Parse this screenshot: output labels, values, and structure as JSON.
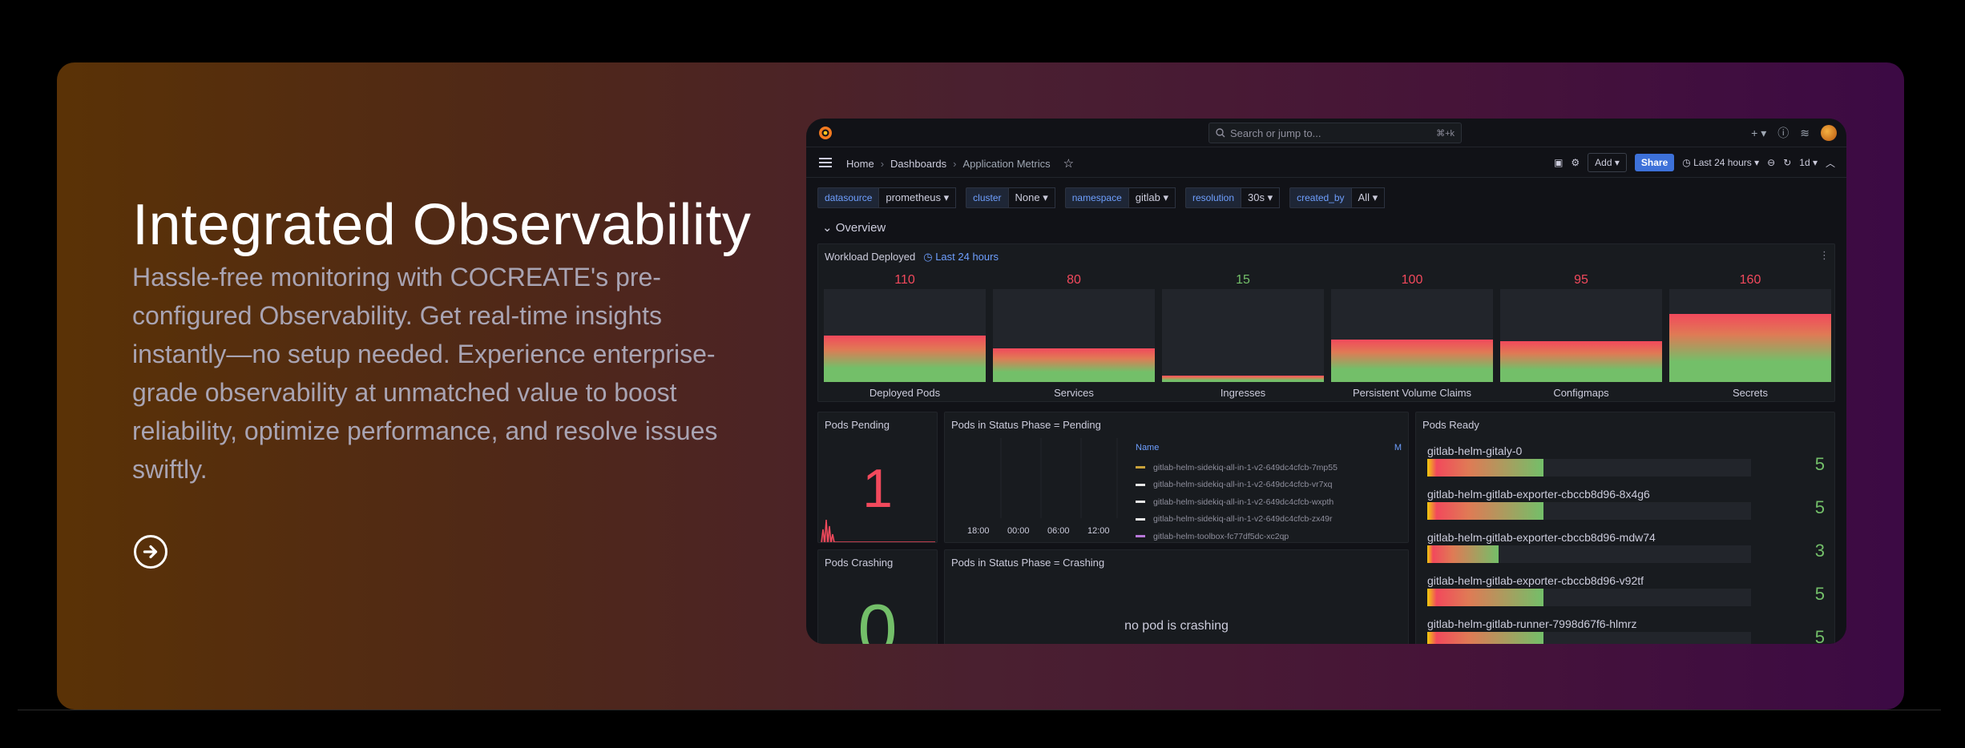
{
  "hero": {
    "title": "Integrated Observability",
    "description": "Hassle-free monitoring with COCREATE's pre-configured Observability. Get real-time insights instantly—no setup needed. Experience enterprise-grade observability at unmatched value to boost reliability, optimize performance, and resolve issues swiftly."
  },
  "grafana": {
    "search_placeholder": "Search or jump to...",
    "search_shortcut": "⌘+k",
    "breadcrumb": [
      "Home",
      "Dashboards",
      "Application Metrics"
    ],
    "nav": {
      "add_label": "Add",
      "share_label": "Share",
      "time_range": "Last 24 hours",
      "refresh_interval": "1d"
    },
    "variables": [
      {
        "label": "datasource",
        "value": "prometheus"
      },
      {
        "label": "cluster",
        "value": "None"
      },
      {
        "label": "namespace",
        "value": "gitlab"
      },
      {
        "label": "resolution",
        "value": "30s"
      },
      {
        "label": "created_by",
        "value": "All"
      }
    ],
    "row_title": "Overview",
    "workload": {
      "title": "Workload Deployed",
      "time": "Last 24 hours",
      "stats": [
        {
          "label": "Deployed Pods",
          "value": "110",
          "fraction": 0.5,
          "color": "#f2495c"
        },
        {
          "label": "Services",
          "value": "80",
          "fraction": 0.36,
          "color": "#f2495c"
        },
        {
          "label": "Ingresses",
          "value": "15",
          "fraction": 0.07,
          "color": "#73bf69"
        },
        {
          "label": "Persistent Volume Claims",
          "value": "100",
          "fraction": 0.46,
          "color": "#f2495c"
        },
        {
          "label": "Configmaps",
          "value": "95",
          "fraction": 0.44,
          "color": "#f2495c"
        },
        {
          "label": "Secrets",
          "value": "160",
          "fraction": 0.73,
          "color": "#f2495c"
        }
      ]
    },
    "pods_pending": {
      "title": "Pods Pending",
      "value": "1",
      "color": "#f2495c"
    },
    "pods_crashing": {
      "title": "Pods Crashing",
      "value": "0",
      "color": "#73bf69"
    },
    "phase_pending": {
      "title": "Pods in Status Phase = Pending",
      "x_ticks": [
        "18:00",
        "00:00",
        "06:00",
        "12:00"
      ],
      "legend_header": "Name",
      "legend_header_right": "M",
      "legend": [
        {
          "name": "gitlab-helm-sidekiq-all-in-1-v2-649dc4cfcb-7mp55",
          "color": "#c8a13a"
        },
        {
          "name": "gitlab-helm-sidekiq-all-in-1-v2-649dc4cfcb-vr7xq",
          "color": "#e6e6e6"
        },
        {
          "name": "gitlab-helm-sidekiq-all-in-1-v2-649dc4cfcb-wxpth",
          "color": "#e6e6e6"
        },
        {
          "name": "gitlab-helm-sidekiq-all-in-1-v2-649dc4cfcb-zx49r",
          "color": "#e6e6e6"
        },
        {
          "name": "gitlab-helm-toolbox-fc77df5dc-xc2qp",
          "color": "#b877d9"
        }
      ]
    },
    "phase_crashing": {
      "title": "Pods in Status Phase = Crashing",
      "empty_text": "no pod is crashing"
    },
    "pods_ready": {
      "title": "Pods Ready",
      "items": [
        {
          "name": "gitlab-helm-gitaly-0",
          "value": "5",
          "fraction": 0.36
        },
        {
          "name": "gitlab-helm-gitlab-exporter-cbccb8d96-8x4g6",
          "value": "5",
          "fraction": 0.36
        },
        {
          "name": "gitlab-helm-gitlab-exporter-cbccb8d96-mdw74",
          "value": "3",
          "fraction": 0.22
        },
        {
          "name": "gitlab-helm-gitlab-exporter-cbccb8d96-v92tf",
          "value": "5",
          "fraction": 0.36
        },
        {
          "name": "gitlab-helm-gitlab-runner-7998d67f6-hlmrz",
          "value": "5",
          "fraction": 0.36
        }
      ]
    }
  }
}
